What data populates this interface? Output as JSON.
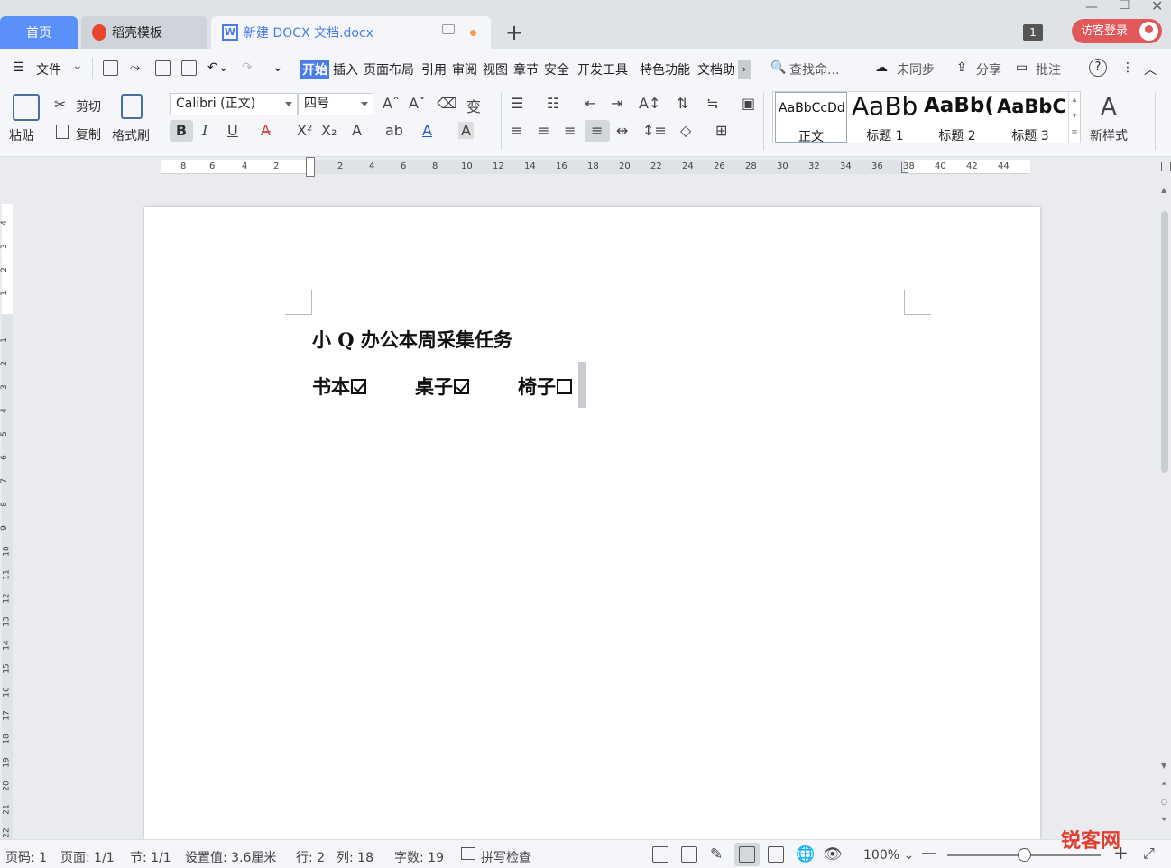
{
  "tabs": {
    "home": "首页",
    "template": "稻壳模板",
    "document": "新建 DOCX 文档.docx",
    "window_count": "1",
    "login": "访客登录"
  },
  "menu": {
    "file": "文件",
    "items": [
      "开始",
      "插入",
      "页面布局",
      "引用",
      "审阅",
      "视图",
      "章节",
      "安全",
      "开发工具",
      "特色功能",
      "文档助"
    ],
    "search": "查找命...",
    "sync": "未同步",
    "share": "分享",
    "comment": "批注"
  },
  "ribbon": {
    "paste": "粘贴",
    "cut": "剪切",
    "copy": "复制",
    "format_painter": "格式刷",
    "font_name": "Calibri (正文)",
    "font_size": "四号",
    "styles": [
      {
        "sample": "AaBbCcDd",
        "name": "正文"
      },
      {
        "sample": "AaBb",
        "name": "标题 1"
      },
      {
        "sample": "AaBb(",
        "name": "标题 2"
      },
      {
        "sample": "AaBbC",
        "name": "标题 3"
      }
    ],
    "new_style": "新样式"
  },
  "ruler_ticks": [
    "8",
    "6",
    "4",
    "2",
    "2",
    "4",
    "6",
    "8",
    "10",
    "12",
    "14",
    "16",
    "18",
    "20",
    "22",
    "24",
    "26",
    "28",
    "30",
    "32",
    "34",
    "36",
    "38",
    "40",
    "42",
    "44"
  ],
  "vruler_ticks": [
    "4",
    "3",
    "2",
    "1",
    "1",
    "2",
    "3",
    "4",
    "5",
    "6",
    "7",
    "8",
    "9",
    "10",
    "11",
    "12",
    "13",
    "14",
    "15",
    "16",
    "17",
    "18",
    "19",
    "20",
    "21",
    "22"
  ],
  "document": {
    "title": "小 Q 办公本周采集任务",
    "items": [
      {
        "label": "书本",
        "checked": true
      },
      {
        "label": "桌子",
        "checked": true
      },
      {
        "label": "椅子",
        "checked": false
      }
    ]
  },
  "status": {
    "page_num": "页码: 1",
    "pages": "页面: 1/1",
    "section": "节: 1/1",
    "setting": "设置值: 3.6厘米",
    "row": "行: 2",
    "col": "列: 18",
    "words": "字数: 19",
    "spell": "拼写检查",
    "zoom": "100%"
  },
  "watermark": "锐客网"
}
